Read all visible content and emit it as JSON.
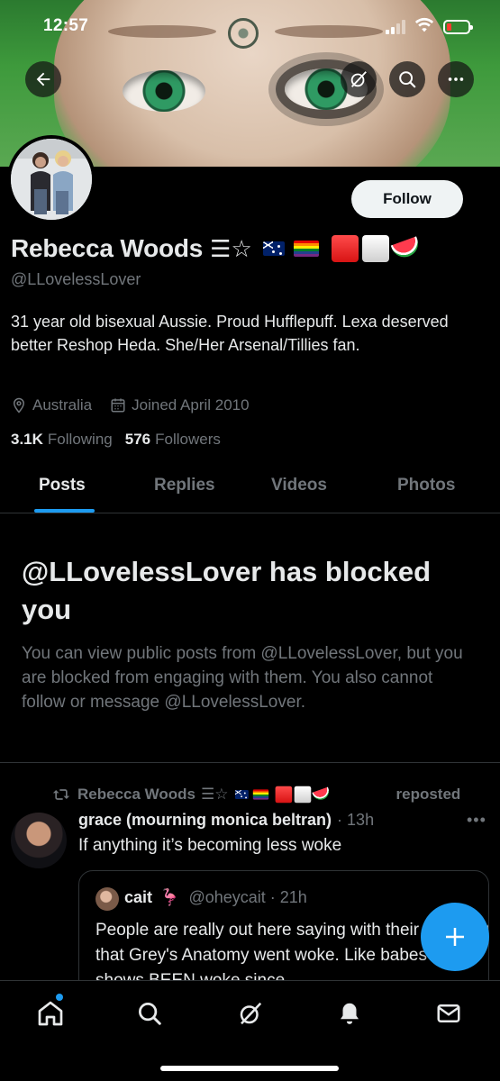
{
  "status_bar": {
    "time": "12:57"
  },
  "profile": {
    "name": "Rebecca Woods",
    "name_symbols": "☰☆",
    "handle": "@LLovelessLover",
    "bio": "31 year old bisexual Aussie. Proud Hufflepuff. Lexa deserved better Reshop Heda. She/Her Arsenal/Tillies fan.",
    "location": "Australia",
    "joined": "Joined April 2010",
    "following_count": "3.1K",
    "following_label": "Following",
    "followers_count": "576",
    "followers_label": "Followers",
    "follow_button": "Follow"
  },
  "tabs": [
    {
      "label": "Posts",
      "active": true
    },
    {
      "label": "Replies",
      "active": false
    },
    {
      "label": "Videos",
      "active": false
    },
    {
      "label": "Photos",
      "active": false
    }
  ],
  "blocked": {
    "title": "@LLovelessLover has blocked you",
    "message": "You can view public posts from @LLovelessLover, but you are blocked from engaging with them. You also cannot follow or message @LLovelessLover."
  },
  "post": {
    "repost_by": "Rebecca Woods",
    "repost_label": "reposted",
    "author": "grace (mourning monica beltran)",
    "time": "· 13h",
    "text": "If anything it’s becoming less woke",
    "more": "•••",
    "quote": {
      "author": "cait",
      "author_emoji": "🦩",
      "handle_time": "@oheycait · 21h",
      "text": "People are really out here saying with their full chest that Grey's Anatomy went woke. Like babes the shows BEEN woke since"
    }
  },
  "colors": {
    "accent": "#1d9bf0",
    "background": "#000000",
    "text_primary": "#e7e9ea",
    "text_secondary": "#71767b",
    "border": "#2f3336"
  },
  "icons": {
    "back": "arrow-left-icon",
    "grok": "grok-icon",
    "search": "search-icon",
    "more": "more-icon",
    "location": "location-pin-icon",
    "calendar": "calendar-icon",
    "repost": "repost-icon",
    "compose": "plus-icon",
    "nav": [
      "home-icon",
      "search-icon",
      "grok-icon",
      "bell-icon",
      "mail-icon"
    ]
  }
}
